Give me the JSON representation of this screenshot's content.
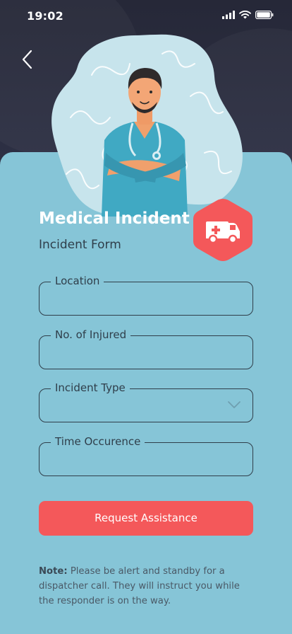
{
  "status_bar": {
    "time": "19:02"
  },
  "header": {
    "title": "Medical Incident",
    "subtitle": "Incident Form"
  },
  "form": {
    "fields": [
      {
        "label": "Location",
        "value": ""
      },
      {
        "label": "No. of Injured",
        "value": ""
      },
      {
        "label": "Incident Type",
        "value": ""
      },
      {
        "label": "Time Occurence",
        "value": ""
      }
    ],
    "submit_label": "Request Assistance"
  },
  "note": {
    "prefix": "Note:",
    "text": " Please be alert and standby for a dispatcher call. They will instruct you while the responder is on the way."
  },
  "icons": {
    "back": "chevron-left-icon",
    "ambulance": "ambulance-icon",
    "dropdown": "chevron-down-icon",
    "signal": "signal-icon",
    "wifi": "wifi-icon",
    "battery": "battery-icon"
  },
  "colors": {
    "card": "#86c5d7",
    "accent": "#f4585a",
    "dark": "#2a2c3e",
    "text": "#2f3e4a"
  }
}
